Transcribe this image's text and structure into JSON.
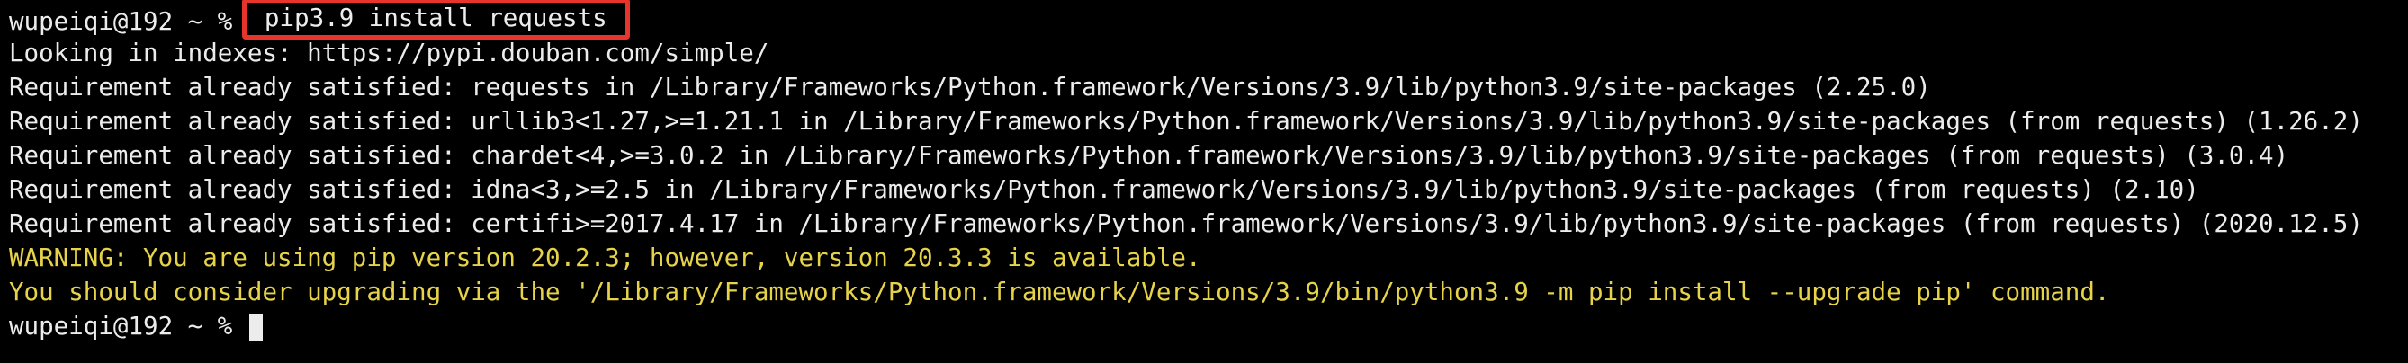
{
  "terminal": {
    "prompt_1": "wupeiqi@192 ~ % ",
    "command": "pip3.9 install requests",
    "lines": [
      "Looking in indexes: https://pypi.douban.com/simple/",
      "Requirement already satisfied: requests in /Library/Frameworks/Python.framework/Versions/3.9/lib/python3.9/site-packages (2.25.0)",
      "Requirement already satisfied: urllib3<1.27,>=1.21.1 in /Library/Frameworks/Python.framework/Versions/3.9/lib/python3.9/site-packages (from requests) (1.26.2)",
      "Requirement already satisfied: chardet<4,>=3.0.2 in /Library/Frameworks/Python.framework/Versions/3.9/lib/python3.9/site-packages (from requests) (3.0.4)",
      "Requirement already satisfied: idna<3,>=2.5 in /Library/Frameworks/Python.framework/Versions/3.9/lib/python3.9/site-packages (from requests) (2.10)",
      "Requirement already satisfied: certifi>=2017.4.17 in /Library/Frameworks/Python.framework/Versions/3.9/lib/python3.9/site-packages (from requests) (2020.12.5)"
    ],
    "warning_1": "WARNING: You are using pip version 20.2.3; however, version 20.3.3 is available.",
    "warning_2": "You should consider upgrading via the '/Library/Frameworks/Python.framework/Versions/3.9/bin/python3.9 -m pip install --upgrade pip' command.",
    "prompt_2": "wupeiqi@192 ~ % ",
    "colors": {
      "background": "#000000",
      "text": "#ececec",
      "warning": "#e6d34a",
      "highlight_box": "#e8352b"
    }
  }
}
